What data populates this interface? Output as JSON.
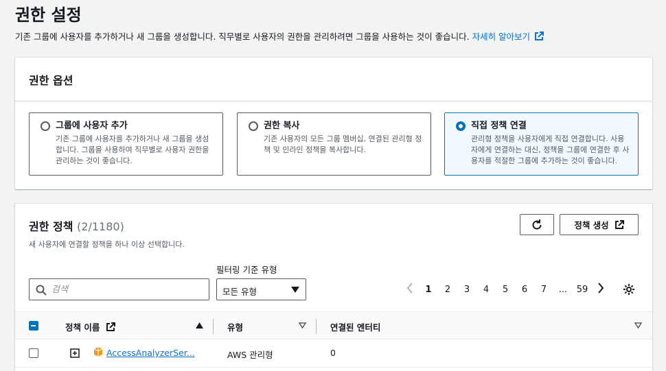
{
  "page": {
    "title": "권한 설정",
    "description": "기존 그룹에 사용자를 추가하거나 새 그룹을 생성합니다. 직무별로 사용자의 권한을 관리하려면 그룹을 사용하는 것이 좋습니다.",
    "learn_more": "자세히 알아보기",
    "link_color": "#0972d3"
  },
  "options": {
    "heading": "권한 옵션",
    "tiles": [
      {
        "title": "그룹에 사용자 추가",
        "desc": "기존 그룹에 사용자를 추가하거나 새 그룹을 생성합니다. 그룹을 사용하여 직무별로 사용자 권한을 관리하는 것이 좋습니다.",
        "selected": false
      },
      {
        "title": "권한 복사",
        "desc": "기존 사용자의 모든 그룹 멤버십, 연결된 관리형 정책 및 인라인 정책을 복사합니다.",
        "selected": false
      },
      {
        "title": "직접 정책 연결",
        "desc": "관리형 정책을 사용자에게 직접 연결합니다. 사용자에게 연결하는 대신, 정책을 그룹에 연결한 후 사용자를 적절한 그룹에 추가하는 것이 좋습니다.",
        "selected": true
      }
    ]
  },
  "policies": {
    "title": "권한 정책",
    "count": "(2/1180)",
    "subtitle": "새 사용자에 연결할 정책을 하나 이상 선택합니다.",
    "refresh_icon": "refresh-icon",
    "create_label": "정책 생성",
    "filter_label": "필터링 기준 유형",
    "search_placeholder": "검색",
    "type_select": "모든 유형",
    "pagination": {
      "current": "1",
      "pages": [
        "1",
        "2",
        "3",
        "4",
        "5",
        "6",
        "7",
        "...",
        "59"
      ]
    },
    "columns": [
      "정책 이름",
      "유형",
      "연결된 엔터티"
    ],
    "rows": [
      {
        "name": "AccessAnalyzerSer...",
        "type": "AWS 관리형",
        "entities": "0"
      }
    ]
  }
}
